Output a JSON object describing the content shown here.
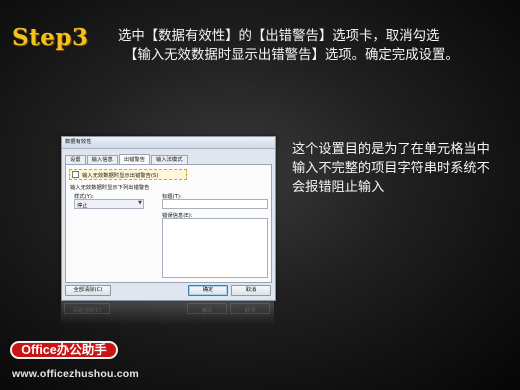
{
  "step": {
    "label": "Step3"
  },
  "instruction": {
    "line1": "选中【数据有效性】的【出错警告】选项卡，取消勾选",
    "line2": "【输入无效数据时显示出错警告】选项。确定完成设置。"
  },
  "note": {
    "text": "这个设置目的是为了在单元格当中输入不完整的项目字符串时系统不会报错阻止输入"
  },
  "dialog": {
    "title": "数据有效性",
    "tabs": [
      "设置",
      "输入信息",
      "出错警告",
      "输入法模式"
    ],
    "active_tab": "出错警告",
    "checkbox_label": "输入无效数据时显示出错警告(S)",
    "checkbox_checked": false,
    "section_label": "输入无效数据时显示下列出错警告",
    "style_label": "样式(Y):",
    "style_value": "停止",
    "title_label": "标题(T):",
    "title_value": "",
    "error_label": "错误信息(E):",
    "error_value": "",
    "clear_all_button": "全部清除(C)",
    "ok_button": "确定",
    "cancel_button": "取消"
  },
  "logo": {
    "text": "Office办公助手"
  },
  "footer": {
    "url": "www.officezhushou.com"
  },
  "colors": {
    "step": "#f4c21c",
    "logo_bg": "#c81414",
    "highlight": "#e0a418"
  }
}
